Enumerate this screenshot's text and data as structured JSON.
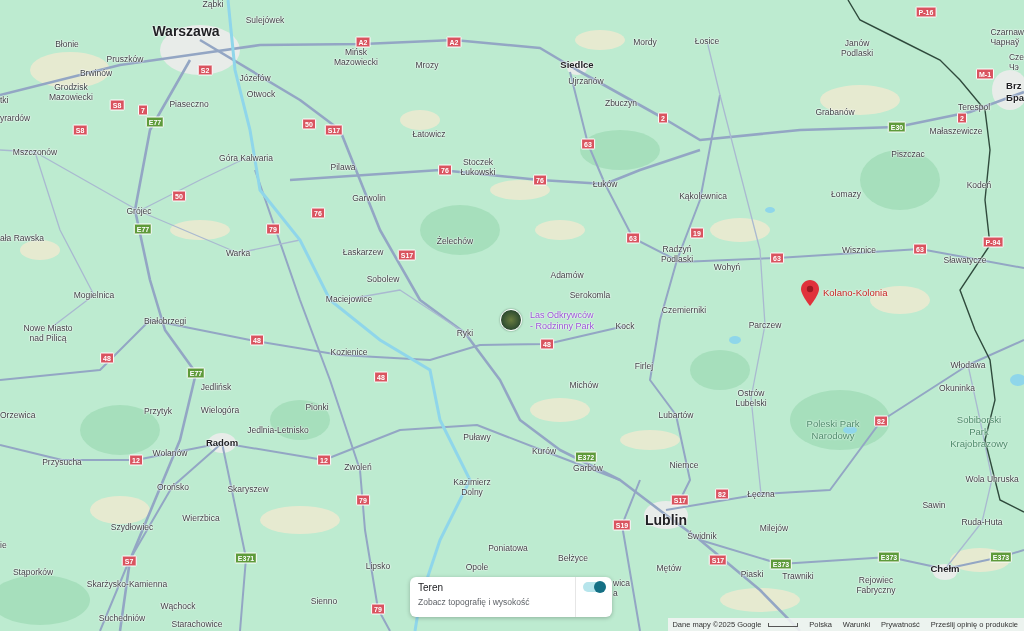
{
  "map": {
    "places": [
      {
        "name": "Ząbki",
        "kind": "town"
      },
      {
        "name": "Sulejówek",
        "kind": "town"
      },
      {
        "name": "Warszawa",
        "kind": "major"
      },
      {
        "name": "Błonie",
        "kind": "town"
      },
      {
        "name": "Pruszków",
        "kind": "town"
      },
      {
        "name": "Brwinów",
        "kind": "town"
      },
      {
        "name": "Grodzisk\nMazowiecki",
        "kind": "town"
      },
      {
        "name": "Józefów",
        "kind": "town"
      },
      {
        "name": "Otwock",
        "kind": "town"
      },
      {
        "name": "tki",
        "kind": "town"
      },
      {
        "name": "Piaseczno",
        "kind": "town"
      },
      {
        "name": "yrardów",
        "kind": "town"
      },
      {
        "name": "Mszczonów",
        "kind": "town"
      },
      {
        "name": "Góra Kalwaria",
        "kind": "town"
      },
      {
        "name": "Grójec",
        "kind": "town"
      },
      {
        "name": "ała Rawska",
        "kind": "town"
      },
      {
        "name": "Warka",
        "kind": "town"
      },
      {
        "name": "Mogielnica",
        "kind": "town"
      },
      {
        "name": "Mińsk\nMazowiecki",
        "kind": "town"
      },
      {
        "name": "Mrozy",
        "kind": "town"
      },
      {
        "name": "Siedlce",
        "kind": "city"
      },
      {
        "name": "Ujrzanów",
        "kind": "town"
      },
      {
        "name": "Mordy",
        "kind": "town"
      },
      {
        "name": "Zbuczyn",
        "kind": "town"
      },
      {
        "name": "Łatowicz",
        "kind": "town"
      },
      {
        "name": "Pilawa",
        "kind": "town"
      },
      {
        "name": "Stoczek\nŁukowski",
        "kind": "town"
      },
      {
        "name": "Łuków",
        "kind": "town"
      },
      {
        "name": "Garwolin",
        "kind": "town"
      },
      {
        "name": "Żelechów",
        "kind": "town"
      },
      {
        "name": "Łaskarzew",
        "kind": "town"
      },
      {
        "name": "Sobolew",
        "kind": "town"
      },
      {
        "name": "Maciejowice",
        "kind": "town"
      },
      {
        "name": "Adamów",
        "kind": "town"
      },
      {
        "name": "Serokomla",
        "kind": "town"
      },
      {
        "name": "Łosice",
        "kind": "town"
      },
      {
        "name": "Janów\nPodlaski",
        "kind": "town"
      },
      {
        "name": "Grabanów",
        "kind": "town"
      },
      {
        "name": "Terespol",
        "kind": "town"
      },
      {
        "name": "Małaszewicze",
        "kind": "town"
      },
      {
        "name": "Piszczac",
        "kind": "town"
      },
      {
        "name": "Kodeń",
        "kind": "town"
      },
      {
        "name": "Kąkolewnica",
        "kind": "town"
      },
      {
        "name": "Łomazy",
        "kind": "town"
      },
      {
        "name": "Radzyń\nPodlaski",
        "kind": "town"
      },
      {
        "name": "Wohyń",
        "kind": "town"
      },
      {
        "name": "Wisznice",
        "kind": "town"
      },
      {
        "name": "Sławatycze",
        "kind": "town"
      },
      {
        "name": "Czemierniki",
        "kind": "town"
      },
      {
        "name": "Czarnaw\nЧарнаў",
        "kind": "town"
      },
      {
        "name": "Cze\nЧэ",
        "kind": "town"
      },
      {
        "name": "Brz\nБра",
        "kind": "city"
      },
      {
        "name": "Nowe Miasto\nnad Pilicą",
        "kind": "town"
      },
      {
        "name": "Białobrzegi",
        "kind": "town"
      },
      {
        "name": "Kozienice",
        "kind": "town"
      },
      {
        "name": "Jedlińsk",
        "kind": "town"
      },
      {
        "name": "Przytyk",
        "kind": "town"
      },
      {
        "name": "Wielogóra",
        "kind": "town"
      },
      {
        "name": "Pionki",
        "kind": "town"
      },
      {
        "name": "Orzewica",
        "kind": "town"
      },
      {
        "name": "Jedlnia-Letnisko",
        "kind": "town"
      },
      {
        "name": "Radom",
        "kind": "city"
      },
      {
        "name": "Wolanów",
        "kind": "town"
      },
      {
        "name": "Przysucha",
        "kind": "town"
      },
      {
        "name": "Zwoleń",
        "kind": "town"
      },
      {
        "name": "Orońsko",
        "kind": "town"
      },
      {
        "name": "Skaryszew",
        "kind": "town"
      },
      {
        "name": "Wierzbica",
        "kind": "town"
      },
      {
        "name": "Szydłowiec",
        "kind": "town"
      },
      {
        "name": "ie",
        "kind": "town"
      },
      {
        "name": "Stąporków",
        "kind": "town"
      },
      {
        "name": "Skarżysko-Kamienna",
        "kind": "town"
      },
      {
        "name": "Wąchock",
        "kind": "town"
      },
      {
        "name": "Sienno",
        "kind": "town"
      },
      {
        "name": "Suchedniów",
        "kind": "town"
      },
      {
        "name": "Starachowice",
        "kind": "town"
      },
      {
        "name": "Ryki",
        "kind": "town"
      },
      {
        "name": "Kock",
        "kind": "town"
      },
      {
        "name": "Firlej",
        "kind": "town"
      },
      {
        "name": "Michów",
        "kind": "town"
      },
      {
        "name": "Lubartów",
        "kind": "town"
      },
      {
        "name": "Puławy",
        "kind": "town"
      },
      {
        "name": "Kurów",
        "kind": "town"
      },
      {
        "name": "Niemce",
        "kind": "town"
      },
      {
        "name": "Garbów",
        "kind": "town"
      },
      {
        "name": "Kazimierz\nDolny",
        "kind": "town"
      },
      {
        "name": "Lublin",
        "kind": "major"
      },
      {
        "name": "Poniatowa",
        "kind": "town"
      },
      {
        "name": "Bełżyce",
        "kind": "town"
      },
      {
        "name": "Lipsko",
        "kind": "town"
      },
      {
        "name": "Opole",
        "kind": "town"
      },
      {
        "name": "Mętów",
        "kind": "town"
      },
      {
        "name": "wica\na",
        "kind": "town"
      },
      {
        "name": "Parczew",
        "kind": "town"
      },
      {
        "name": "Włodawa",
        "kind": "town"
      },
      {
        "name": "Okuninka",
        "kind": "town"
      },
      {
        "name": "Ostrów\nLubelski",
        "kind": "town"
      },
      {
        "name": "Poleski Park\nNarodowy",
        "kind": "park"
      },
      {
        "name": "Sobiborski\nPark\nKrajobrazowy",
        "kind": "park"
      },
      {
        "name": "Wola Uhruska",
        "kind": "town"
      },
      {
        "name": "Łęczna",
        "kind": "town"
      },
      {
        "name": "Sawin",
        "kind": "town"
      },
      {
        "name": "Ruda-Huta",
        "kind": "town"
      },
      {
        "name": "Milejów",
        "kind": "town"
      },
      {
        "name": "Świdnik",
        "kind": "town"
      },
      {
        "name": "Piaski",
        "kind": "town"
      },
      {
        "name": "Trawniki",
        "kind": "town"
      },
      {
        "name": "Chełm",
        "kind": "city"
      },
      {
        "name": "Rejowiec\nFabryczny",
        "kind": "town"
      }
    ],
    "road_shields": [
      {
        "label": "A2",
        "kind": "national"
      },
      {
        "label": "A2",
        "kind": "national"
      },
      {
        "label": "S2",
        "kind": "national"
      },
      {
        "label": "S8",
        "kind": "national"
      },
      {
        "label": "S8",
        "kind": "national"
      },
      {
        "label": "7",
        "kind": "national"
      },
      {
        "label": "E77",
        "kind": "european"
      },
      {
        "label": "50",
        "kind": "national"
      },
      {
        "label": "S17",
        "kind": "national"
      },
      {
        "label": "50",
        "kind": "national"
      },
      {
        "label": "76",
        "kind": "national"
      },
      {
        "label": "76",
        "kind": "national"
      },
      {
        "label": "76",
        "kind": "national"
      },
      {
        "label": "63",
        "kind": "national"
      },
      {
        "label": "2",
        "kind": "national"
      },
      {
        "label": "63",
        "kind": "national"
      },
      {
        "label": "E77",
        "kind": "european"
      },
      {
        "label": "79",
        "kind": "national"
      },
      {
        "label": "S17",
        "kind": "national"
      },
      {
        "label": "19",
        "kind": "national"
      },
      {
        "label": "63",
        "kind": "national"
      },
      {
        "label": "63",
        "kind": "national"
      },
      {
        "label": "P-16",
        "kind": "national"
      },
      {
        "label": "M-1",
        "kind": "national"
      },
      {
        "label": "2",
        "kind": "national"
      },
      {
        "label": "E30",
        "kind": "european"
      },
      {
        "label": "P-94",
        "kind": "national"
      },
      {
        "label": "48",
        "kind": "national"
      },
      {
        "label": "48",
        "kind": "national"
      },
      {
        "label": "48",
        "kind": "national"
      },
      {
        "label": "48",
        "kind": "national"
      },
      {
        "label": "E77",
        "kind": "european"
      },
      {
        "label": "12",
        "kind": "national"
      },
      {
        "label": "12",
        "kind": "national"
      },
      {
        "label": "79",
        "kind": "national"
      },
      {
        "label": "79",
        "kind": "national"
      },
      {
        "label": "E372",
        "kind": "european"
      },
      {
        "label": "S17",
        "kind": "national"
      },
      {
        "label": "S19",
        "kind": "national"
      },
      {
        "label": "82",
        "kind": "national"
      },
      {
        "label": "82",
        "kind": "national"
      },
      {
        "label": "S7",
        "kind": "national"
      },
      {
        "label": "E371",
        "kind": "european"
      },
      {
        "label": "E373",
        "kind": "european"
      },
      {
        "label": "E373",
        "kind": "european"
      },
      {
        "label": "E373",
        "kind": "european"
      },
      {
        "label": "S17",
        "kind": "national"
      }
    ],
    "poi": {
      "label": "Las Odkrywców\n- Rodzinny Park"
    },
    "pin": {
      "label": "Kolano-Kolonia"
    }
  },
  "terrain_card": {
    "title": "Teren",
    "subtitle": "Zobacz topografię i wysokość",
    "on": true
  },
  "footer": {
    "attribution": "Dane mapy ©2025 Google",
    "links": [
      "Polska",
      "Warunki",
      "Prywatność",
      "Prześlij opinię o produkcie"
    ]
  }
}
